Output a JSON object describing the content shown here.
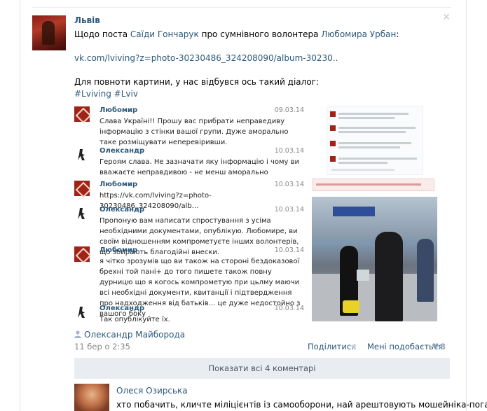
{
  "post": {
    "author": "Львів",
    "line1_prefix": "Щодо поста ",
    "line1_link1": "Саїди Гончарук",
    "line1_mid": " про сумнівного волонтера ",
    "line1_link2": "Любомира Урбан",
    "line1_suffix": ":",
    "url": "vk.com/lviving?z=photo-30230486_324208090/album-30230..",
    "line3": "Для повноти картини, у нас відбувся ось такий діалог:",
    "hashtag1": "#Lviving",
    "hashtag2": "#Lviv"
  },
  "dialog": [
    {
      "name": "Любомир",
      "date": "09.03.14",
      "avatar": "red",
      "text": "Слава Україні!! Прошу вас прибрати неправедиву інформацію з стінки вашої групи. Дуже аморально таке розміщувати неперевіривши."
    },
    {
      "name": "Олександр",
      "date": "10.03.14",
      "avatar": "black",
      "text": "Героям слава. Не зазначати яку інформацію і чому ви вважаєте неправдивою - не менш аморально"
    },
    {
      "name": "Любомир",
      "date": "10.03.14",
      "avatar": "red",
      "text": "https://vk.com/lviving?z=photo-30230486_324208090/alb..."
    },
    {
      "name": "Олександр",
      "date": "10.03.14",
      "avatar": "black",
      "text": "Пропоную вам написати спростування з усіма необхідними документами, опублікую. Любомире, ви своїм відношенням компрометуєте інших волонтерів, що збирають благодійні внески."
    },
    {
      "name": "Любомир",
      "date": "10.03.14",
      "avatar": "red",
      "text": "я чітко зрозумів що ви також на стороні бездоказової брехні той пані+ до того пишете також повну дурницю що я когось компрометую при цьлму маючи всі необхідні документи, квитанції і підтвердження про надходження від батьків... це дуже недостойно з вашого боку"
    },
    {
      "name": "Олександр",
      "date": "10.03.14",
      "avatar": "black",
      "text": "Так опублікуйте їх."
    }
  ],
  "footer": {
    "sharer": "Олександр Майборода",
    "date": "11 бер о 2:35",
    "share_label": "Поділитися",
    "like_label": "Мені подобається",
    "like_count": "8",
    "show_all": "Показати всі 4 коментарі"
  },
  "comment": {
    "author": "Олеся Озирська",
    "text": "хто побачить, кличте міліцієнтів із самооборони, най арештовують мошейніка-поганця"
  },
  "colors": {
    "link": "#2b587a",
    "muted": "#8a8a8a",
    "button_bg": "#e9edf1"
  },
  "icons": [
    "close-icon",
    "person-icon",
    "share-icon",
    "heart-icon"
  ]
}
